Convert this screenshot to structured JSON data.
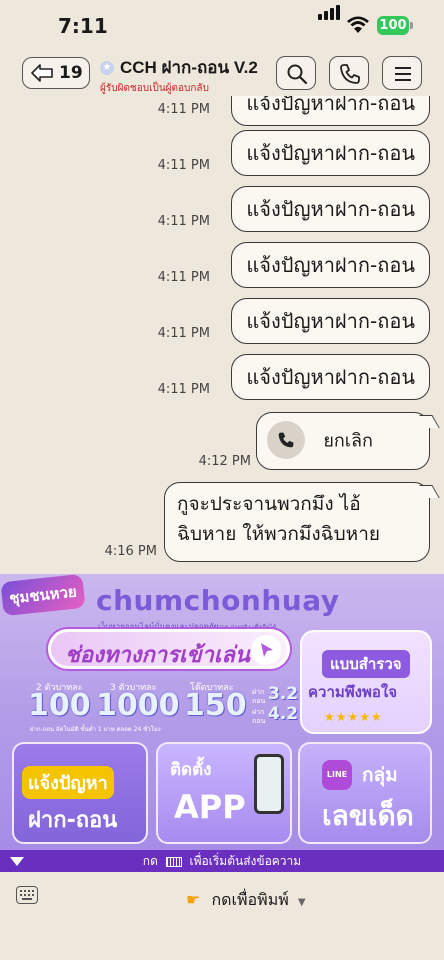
{
  "status": {
    "time": "7:11",
    "battery": "100"
  },
  "header": {
    "back_count": "19",
    "title": "CCH ฝาก-ถอน V.2",
    "subtitle": "ผู้รับผิดชอบเป็นผู้ตอบกลับ"
  },
  "messages": [
    {
      "time": "4:11 PM",
      "text": "แจ้งปัญหาฝาก-ถอน"
    },
    {
      "time": "4:11 PM",
      "text": "แจ้งปัญหาฝาก-ถอน"
    },
    {
      "time": "4:11 PM",
      "text": "แจ้งปัญหาฝาก-ถอน"
    },
    {
      "time": "4:11 PM",
      "text": "แจ้งปัญหาฝาก-ถอน"
    },
    {
      "time": "4:11 PM",
      "text": "แจ้งปัญหาฝาก-ถอน"
    },
    {
      "time": "4:11 PM",
      "text": "แจ้งปัญหาฝาก-ถอน"
    }
  ],
  "call_message": {
    "time": "4:12 PM",
    "text": "ยกเลิก"
  },
  "last_message": {
    "time": "4:16 PM",
    "line1": "กูจะประจานพวกมึง ไอ้",
    "line2": "ฉิบหาย ให้พวกมึงฉิบหาย"
  },
  "banner": {
    "logo": "ชุมชนหวย",
    "brand": "chumchonhuay",
    "brand_sub": "เว็บหวยออนไลน์มั่นคงและปลอดภัย",
    "brand_sub2": "แทงง่าย จ่ายจริง เชื่อถือได้",
    "play_button": "ช่องทางการเข้าเล่น",
    "survey_title": "แบบสำรวจ",
    "survey_sub": "ความพึงพอใจ",
    "survey_stars": "★★★★★",
    "rate_labels": [
      "2 ตัวบาทละ",
      "3 ตัวบาทละ",
      "โต๊ดบาทละ"
    ],
    "rate_values": [
      "100",
      "1000",
      "150"
    ],
    "stat_labels": [
      "ฝาก\nถอน",
      "ฝาก\nถอน"
    ],
    "stat_values": [
      "3.2",
      "4.2"
    ],
    "micro": "ฝาก-ถอน อัตโนมัติ  ขั้นต่ำ 1 บาท  ตลอด 24 ชั่วโมง",
    "card1_tag": "แจ้งปัญหา",
    "card1_big": "ฝาก-ถอน",
    "card2_tag": "ติดตั้ง",
    "card2_big": "APP",
    "card3_icon": "LINE",
    "card3_tag": "กลุ่ม",
    "card3_big": "เลขเด็ด"
  },
  "hint": {
    "prefix": "กด",
    "suffix": "เพื่อเริ่มต้นส่งข้อความ"
  },
  "bottom": {
    "type_label": "กดเพื่อพิมพ์"
  },
  "icons": {
    "back": "arrow-left-icon",
    "search": "search-icon",
    "call": "phone-icon",
    "menu": "menu-icon",
    "keyboard": "keyboard-icon",
    "hand": "pointing-hand-icon"
  }
}
